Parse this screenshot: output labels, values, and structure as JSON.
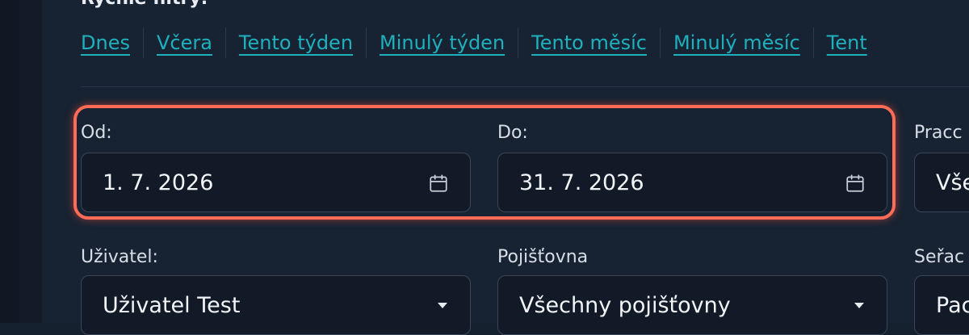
{
  "section": {
    "title": "Rychlé filtry:"
  },
  "quick_filters": [
    "Dnes",
    "Včera",
    "Tento týden",
    "Minulý týden",
    "Tento měsíc",
    "Minulý měsíc",
    "Tent"
  ],
  "date_range": {
    "from_label": "Od:",
    "from_value": "1. 7. 2026",
    "to_label": "Do:",
    "to_value": "31. 7. 2026"
  },
  "right_field_1": {
    "label": "Pracc",
    "value": "Vše"
  },
  "user": {
    "label": "Uživatel:",
    "value": "Uživatel Test"
  },
  "insurer": {
    "label": "Pojišťovna",
    "value": "Všechny pojišťovny"
  },
  "right_field_2": {
    "label": "Seřac",
    "value": "Pac"
  },
  "colors": {
    "background": "#162130",
    "accent_link": "#1fb0be",
    "highlight": "#ff6b57"
  },
  "icons": {
    "calendar": "calendar-icon",
    "dropdown": "chevron-down-icon"
  }
}
